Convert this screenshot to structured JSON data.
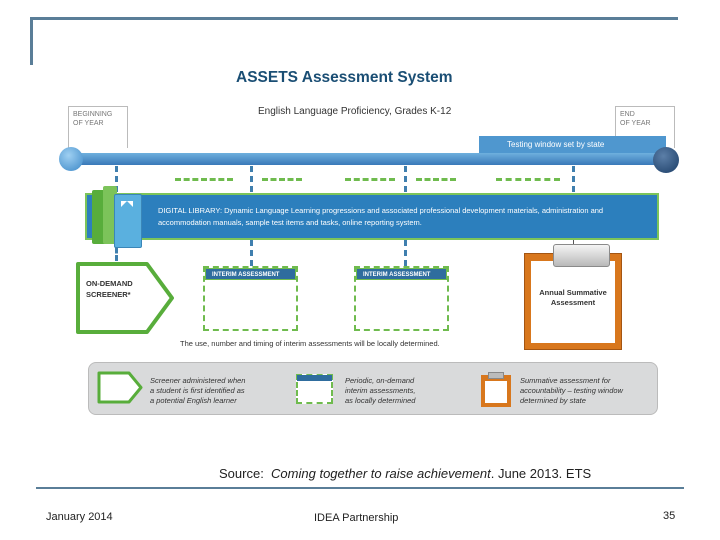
{
  "title": "ASSETS Assessment System",
  "subtitle": "English Language Proficiency, Grades K-12",
  "beginning_of_year": "BEGINNING\nOF YEAR",
  "end_of_year": "END\nOF YEAR",
  "testing_window": "Testing window set by state",
  "digital_library": "DIGITAL LIBRARY: Dynamic Language Learning progressions and associated professional development materials, administration and accommodation manuals, sample test items and tasks, online reporting system.",
  "screener": "ON-DEMAND SCREENER*",
  "interim_1": "INTERIM ASSESSMENT",
  "interim_2": "INTERIM ASSESSMENT",
  "summative": "Annual Summative Assessment",
  "interim_note": "The use, number and timing of interim assessments will be locally determined.",
  "legend": {
    "screener": "Screener administered when\na student is first identified as\na potential English learner",
    "interim": "Periodic, on-demand\ninterim assessments,\nas locally determined",
    "summative": "Summative assessment for\naccountability – testing window\ndetermined by state"
  },
  "source": {
    "prefix": "Source:",
    "title": "Coming together to raise achievement",
    "suffix": ". June 2013. ETS"
  },
  "footer": {
    "date": "January 2014",
    "org": "IDEA Partnership",
    "page": "35"
  },
  "colors": {
    "frame": "#5a7e98",
    "title": "#1a4e74",
    "library_bg": "#2c7fbd",
    "green": "#6fbb4e",
    "summative": "#d8771d"
  }
}
